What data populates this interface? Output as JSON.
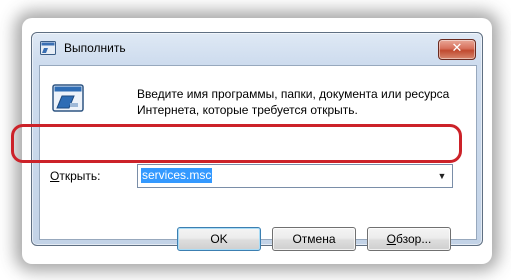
{
  "window": {
    "title": "Выполнить",
    "close_symbol": "✕",
    "description": "Введите имя программы, папки, документа или ресурса Интернета, которые требуется открыть."
  },
  "open_field": {
    "label_accel": "О",
    "label_rest": "ткрыть:",
    "value": "services.msc",
    "dropdown_icon": "▼"
  },
  "buttons": {
    "ok": "OK",
    "cancel": "Отмена",
    "browse_accel": "О",
    "browse_rest": "бзор..."
  },
  "colors": {
    "highlight": "#cc2229",
    "selection": "#3399ff"
  },
  "icons": [
    "run-icon",
    "close-icon",
    "dropdown-arrow-icon"
  ]
}
